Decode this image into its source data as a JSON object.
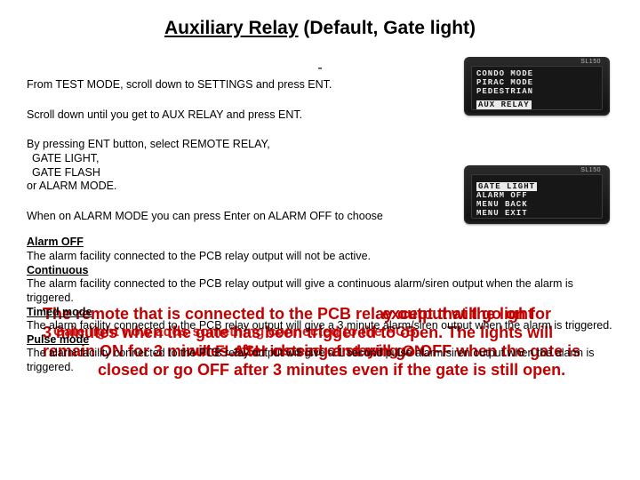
{
  "title_underlined": "Auxiliary Relay",
  "title_rest": " (Default, Gate light)",
  "dash": "-",
  "steps": {
    "s1": "From TEST MODE, scroll down to SETTINGS and press ENT.",
    "s2": "Scroll down until you get to AUX RELAY and press ENT.",
    "s3a": "By pressing ENT button, select REMOTE RELAY,",
    "s3b": "GATE LIGHT,",
    "s3c": "GATE FLASH",
    "s3d": "or ALARM MODE.",
    "s4": "When on ALARM MODE you can press Enter on ALARM OFF to choose"
  },
  "alarm": {
    "off_h": "Alarm OFF",
    "off_t": "The alarm facility connected to the PCB relay output will not be active.",
    "cont_h": "Continuous",
    "cont_t": "The alarm facility connected to the PCB relay output will give a continuous alarm/siren output when the alarm is triggered.",
    "timed_h": "Timed mode",
    "timed_t": "The alarm facility connected to the PCB relay output will give a 3 minute alarm/siren output when the alarm is triggered.",
    "pulse_h": "Pulse mode",
    "pulse_t": "The alarm facility connected to the PCB relay output will give a 1 second pulse alarm/siren output when the alarm is triggered."
  },
  "overlay": {
    "o1": "The remote that is connected to the PCB relay output will go on for",
    "o2": "3 minutes when the gate has been triggered to open. The lights will",
    "o3": "remain ON for 3 minutes after closing and will go OFF when the gate is",
    "o4": "closed or go OFF after 3 minutes even if the gate is still open.",
    "oa": "except that the light",
    "ob": "Gate light now adds something connected to the PCB.",
    "oc": "will FLASH instead of staying ON"
  },
  "lcd_label": "SL150",
  "lcd1": {
    "l1": "CONDO MODE",
    "l2": "PIRAC MODE",
    "l3": "PEDESTRIAN",
    "l4": "AUX RELAY"
  },
  "lcd2": {
    "l1": "GATE LIGHT",
    "l2": "ALARM OFF",
    "l3": "MENU BACK",
    "l4": "MENU EXIT"
  }
}
